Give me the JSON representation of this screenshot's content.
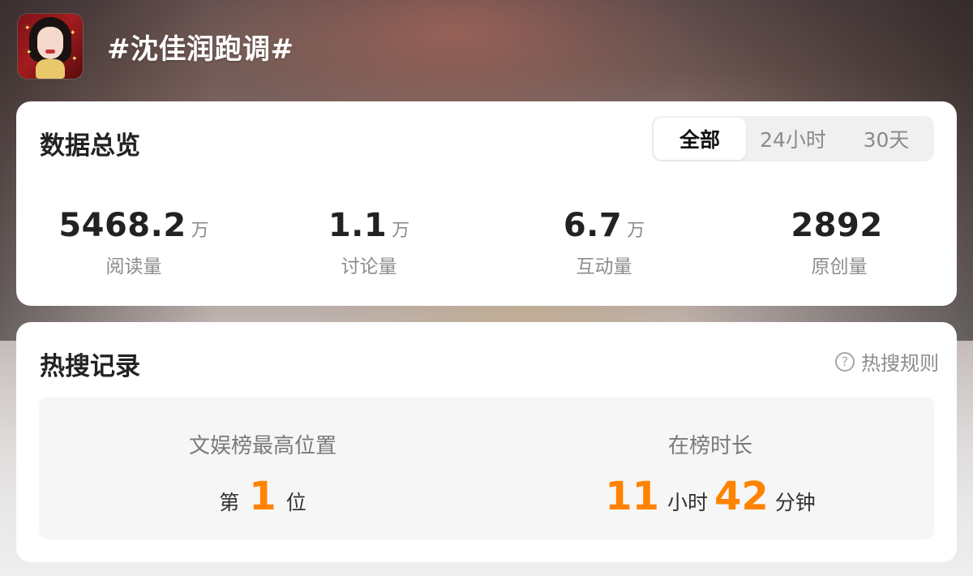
{
  "header": {
    "topic": "#沈佳润跑调#"
  },
  "overview": {
    "title": "数据总览",
    "tabs": [
      {
        "label": "全部",
        "selected": true
      },
      {
        "label": "24小时",
        "selected": false
      },
      {
        "label": "30天",
        "selected": false
      }
    ],
    "stats": [
      {
        "value": "5468.2",
        "unit": "万",
        "label": "阅读量"
      },
      {
        "value": "1.1",
        "unit": "万",
        "label": "讨论量"
      },
      {
        "value": "6.7",
        "unit": "万",
        "label": "互动量"
      },
      {
        "value": "2892",
        "unit": "",
        "label": "原创量"
      }
    ]
  },
  "hot_search": {
    "title": "热搜记录",
    "rules_label": "热搜规则",
    "rules_icon": "question-circle-icon",
    "best_rank": {
      "label": "文娱榜最高位置",
      "prefix": "第",
      "value": "1",
      "suffix": "位"
    },
    "duration": {
      "label": "在榜时长",
      "hours": "11",
      "hours_unit": "小时",
      "minutes": "42",
      "minutes_unit": "分钟"
    }
  },
  "colors": {
    "accent": "#ff8200",
    "card_bg": "#ffffff",
    "text_primary": "#222222",
    "text_secondary": "#8c8c8c"
  }
}
